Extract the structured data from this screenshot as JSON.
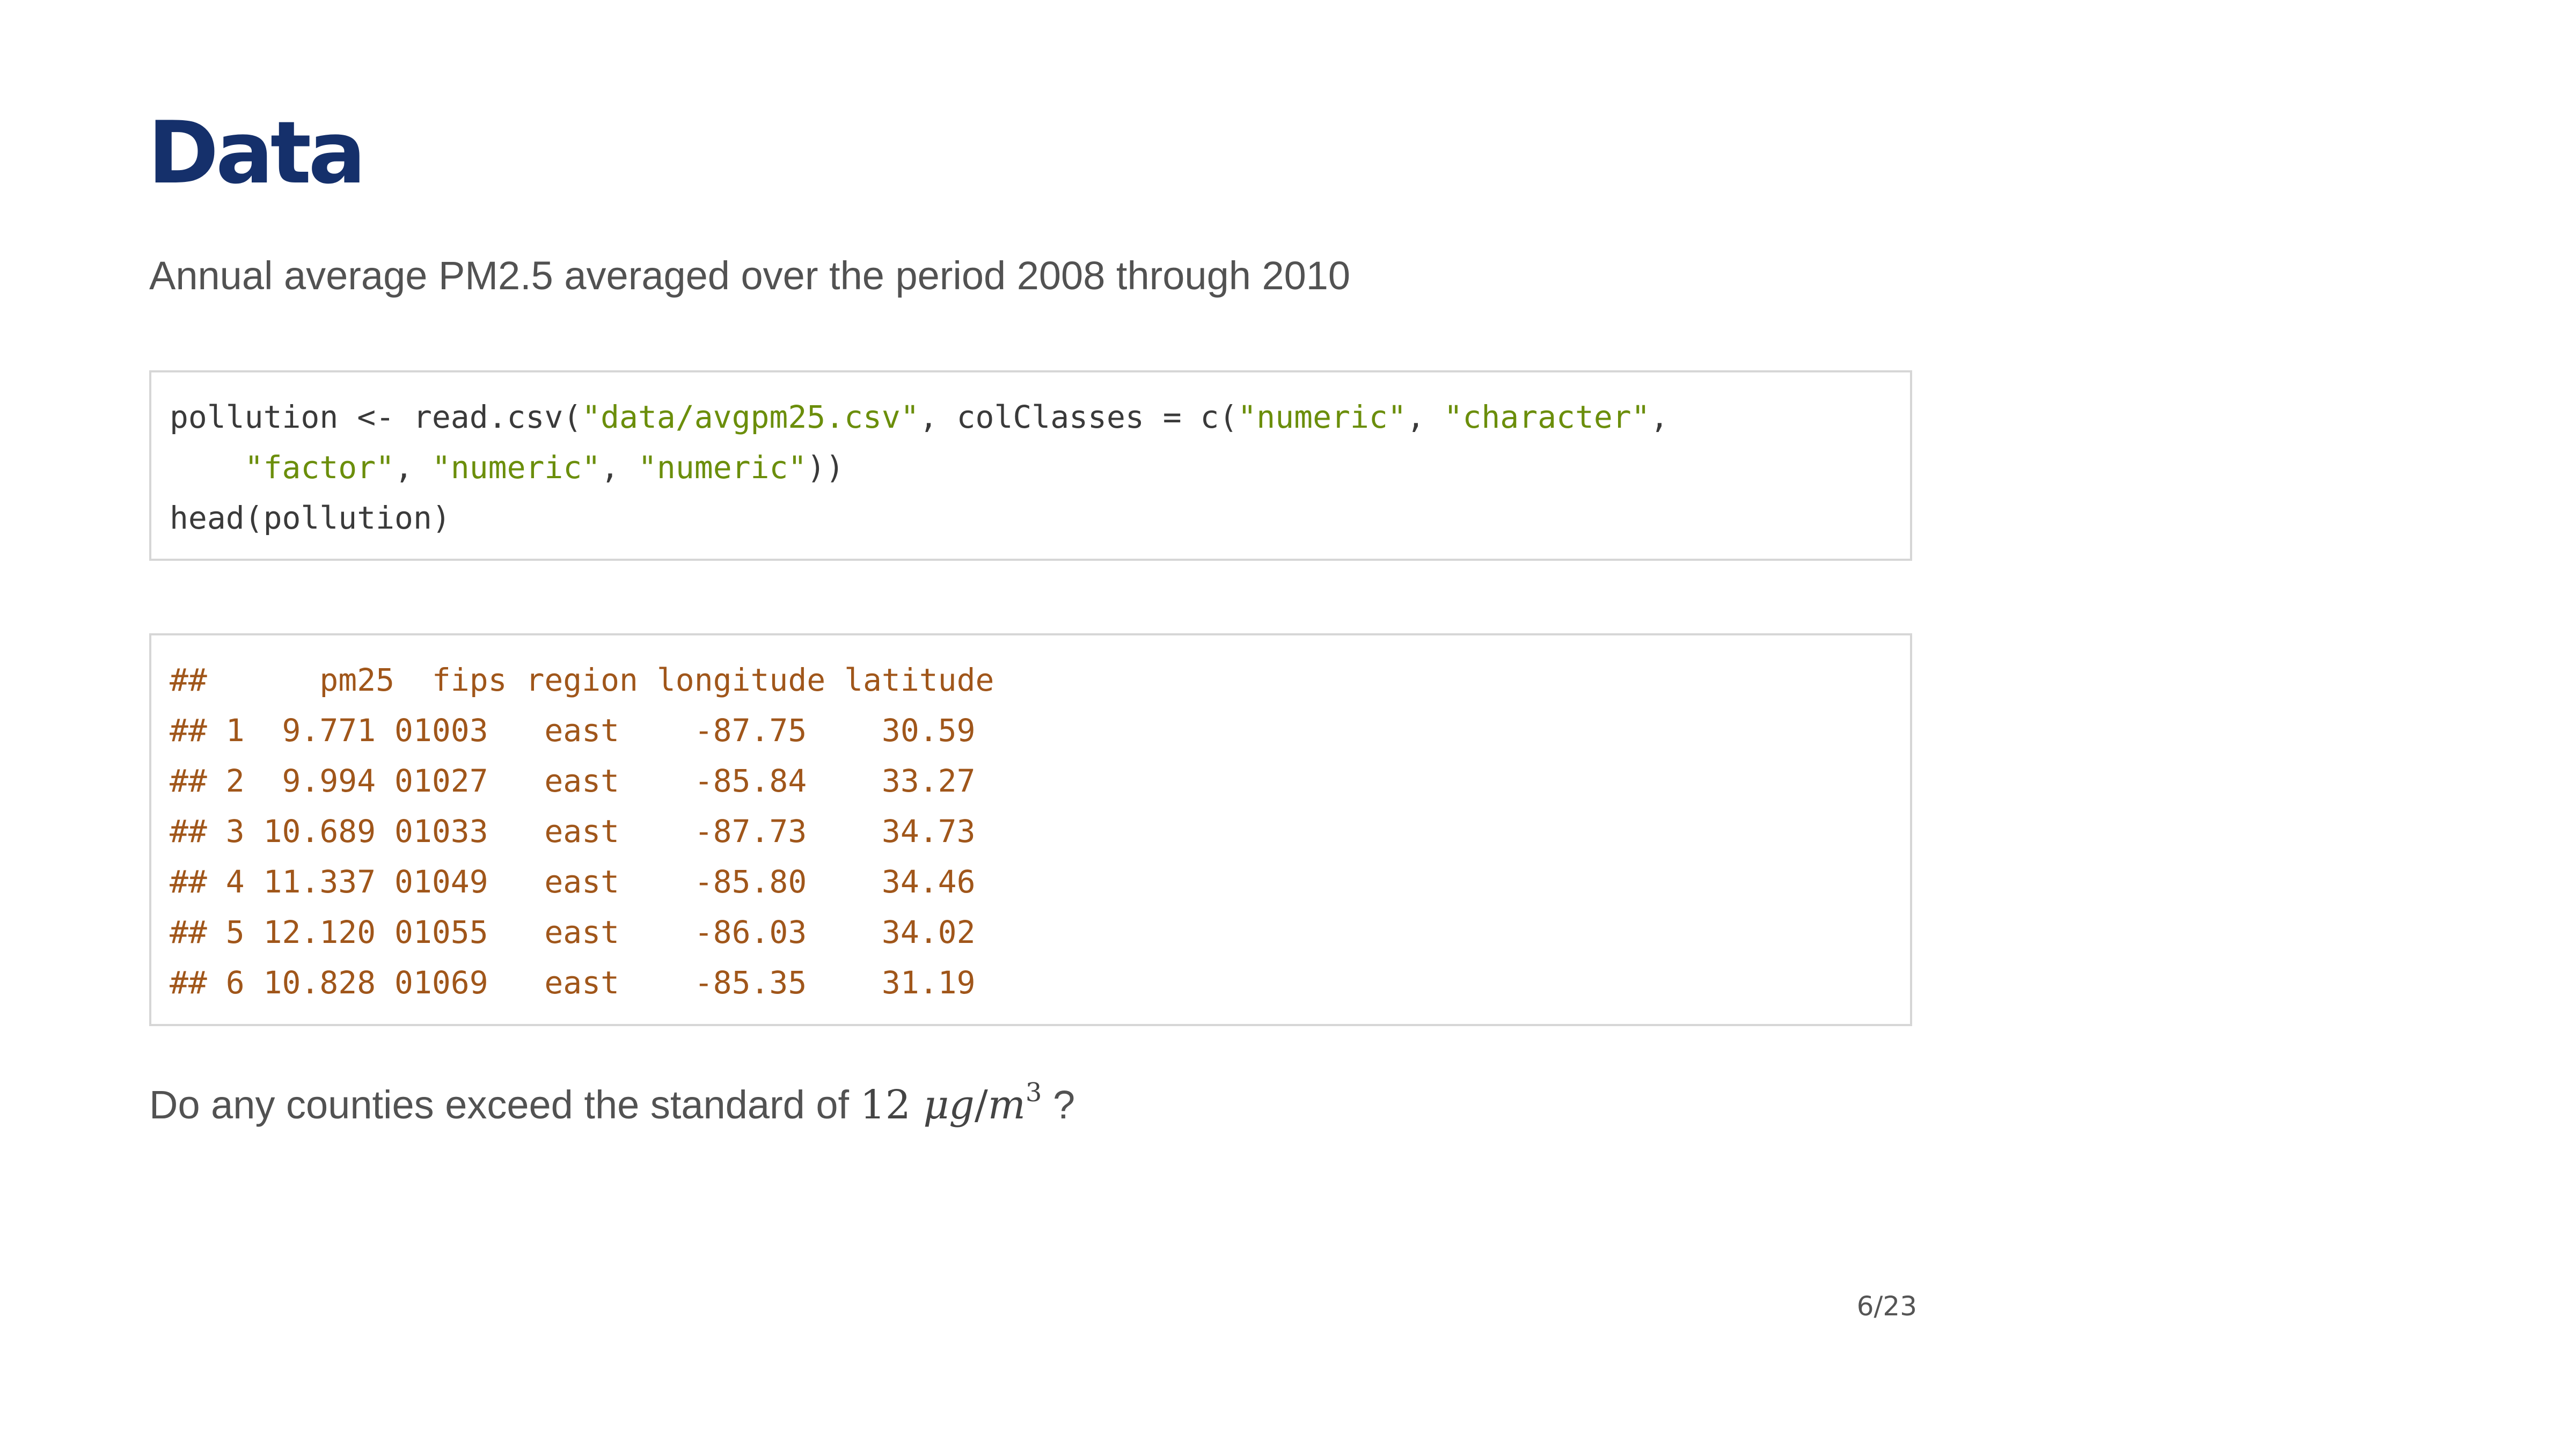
{
  "slide": {
    "title": "Data",
    "subtitle": "Annual average PM2.5 averaged over the period 2008 through 2010",
    "code_input": {
      "line1_a": "pollution <- read.csv(",
      "line1_s1": "\"data/avgpm25.csv\"",
      "line1_b": ", colClasses = c(",
      "line1_s2": "\"numeric\"",
      "line1_c": ", ",
      "line1_s3": "\"character\"",
      "line1_d": ",",
      "line2_a": "    ",
      "line2_s1": "\"factor\"",
      "line2_b": ", ",
      "line2_s2": "\"numeric\"",
      "line2_c": ", ",
      "line2_s3": "\"numeric\"",
      "line2_d": "))",
      "line3": "head(pollution)"
    },
    "code_output": {
      "header": "##      pm25  fips region longitude latitude",
      "rows": [
        "## 1  9.771 01003   east    -87.75    30.59",
        "## 2  9.994 01027   east    -85.84    33.27",
        "## 3 10.689 01033   east    -87.73    34.73",
        "## 4 11.337 01049   east    -85.80    34.46",
        "## 5 12.120 01055   east    -86.03    34.02",
        "## 6 10.828 01069   east    -85.35    31.19"
      ]
    },
    "question": {
      "prefix": "Do any counties exceed the standard of ",
      "math_number": "12",
      "math_unit_mu": "μg",
      "math_unit_slash": "/",
      "math_unit_m": "m",
      "math_exponent": "3",
      "suffix": " ?"
    },
    "page_number": "6/23"
  },
  "colors": {
    "title": "#15306b",
    "body_text": "#525252",
    "code_text": "#3a3a3a",
    "code_string": "#6b8e0b",
    "output_text": "#a0561a",
    "code_border": "#d6d6d6"
  }
}
